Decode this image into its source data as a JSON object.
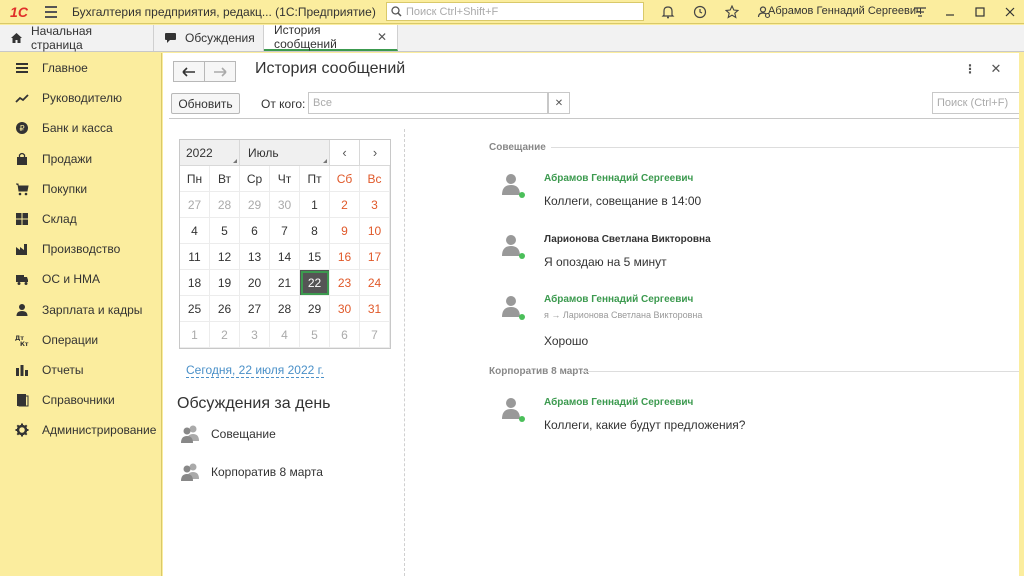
{
  "titlebar": {
    "logo": "1С",
    "title": "Бухгалтерия предприятия, редакц...  (1С:Предприятие)",
    "search_placeholder": "Поиск Ctrl+Shift+F",
    "user": "Абрамов Геннадий Сергеевич"
  },
  "tabs": [
    {
      "label": "Начальная страница",
      "icon": "home-icon"
    },
    {
      "label": "Обсуждения",
      "icon": "chat-icon"
    },
    {
      "label": "История сообщений",
      "icon": "",
      "active": true
    }
  ],
  "sidebar": {
    "items": [
      {
        "label": "Главное",
        "icon": "menu-icon"
      },
      {
        "label": "Руководителю",
        "icon": "trend-icon"
      },
      {
        "label": "Банк и касса",
        "icon": "coin-icon"
      },
      {
        "label": "Продажи",
        "icon": "bag-icon"
      },
      {
        "label": "Покупки",
        "icon": "cart-icon"
      },
      {
        "label": "Склад",
        "icon": "warehouse-icon"
      },
      {
        "label": "Производство",
        "icon": "factory-icon"
      },
      {
        "label": "ОС и НМА",
        "icon": "truck-icon"
      },
      {
        "label": "Зарплата и кадры",
        "icon": "person-icon"
      },
      {
        "label": "Операции",
        "icon": "dt-kt-icon"
      },
      {
        "label": "Отчеты",
        "icon": "bar-chart-icon"
      },
      {
        "label": "Справочники",
        "icon": "books-icon"
      },
      {
        "label": "Администрирование",
        "icon": "gear-icon"
      }
    ]
  },
  "page": {
    "title": "История сообщений",
    "refresh": "Обновить",
    "from_label": "От кого:",
    "from_placeholder": "Все",
    "search_placeholder": "Поиск (Ctrl+F)"
  },
  "calendar": {
    "year": "2022",
    "month": "Июль",
    "dow": [
      "Пн",
      "Вт",
      "Ср",
      "Чт",
      "Пт",
      "Сб",
      "Вс"
    ],
    "weeks": [
      [
        "27",
        "28",
        "29",
        "30",
        "1",
        "2",
        "3"
      ],
      [
        "4",
        "5",
        "6",
        "7",
        "8",
        "9",
        "10"
      ],
      [
        "11",
        "12",
        "13",
        "14",
        "15",
        "16",
        "17"
      ],
      [
        "18",
        "19",
        "20",
        "21",
        "22",
        "23",
        "24"
      ],
      [
        "25",
        "26",
        "27",
        "28",
        "29",
        "30",
        "31"
      ],
      [
        "1",
        "2",
        "3",
        "4",
        "5",
        "6",
        "7"
      ]
    ],
    "selected": "22",
    "today_link": "Сегодня, 22 июля 2022 г."
  },
  "day_discussions": {
    "title": "Обсуждения за день",
    "items": [
      "Совещание",
      "Корпоратив 8 марта"
    ]
  },
  "groups": [
    {
      "title": "Совещание",
      "messages": [
        {
          "author": "Абрамов Геннадий Сергеевич",
          "author_color": "#3c9a4f",
          "to": "",
          "text": "Коллеги, совещание в 14:00"
        },
        {
          "author": "Ларионова Светлана Викторовна",
          "author_color": "#333333",
          "to": "",
          "text": "Я опоздаю на 5 минут"
        },
        {
          "author": "Абрамов Геннадий Сергеевич",
          "author_color": "#3c9a4f",
          "to": "я → Ларионова Светлана Викторовна",
          "text": "Хорошо"
        }
      ]
    },
    {
      "title": "Корпоратив 8 марта",
      "messages": [
        {
          "author": "Абрамов Геннадий Сергеевич",
          "author_color": "#3c9a4f",
          "to": "",
          "text": "Коллеги, какие будут предложения?"
        }
      ]
    }
  ],
  "colors": {
    "accent_green": "#3c9a4f",
    "panel_yellow": "#fbed9e",
    "weekend": "#e0592a",
    "link": "#4a90c8"
  }
}
